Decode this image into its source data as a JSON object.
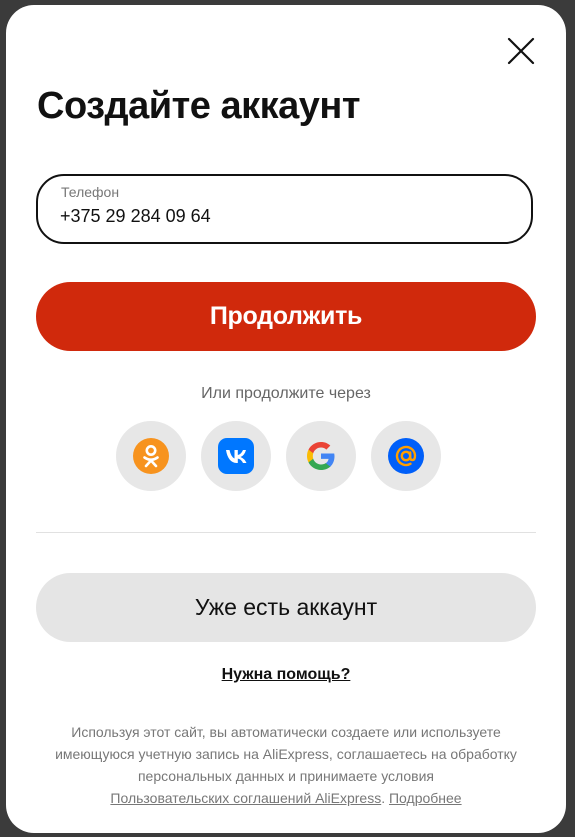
{
  "modal": {
    "title": "Создайте аккаунт",
    "phone": {
      "label": "Телефон",
      "value": "+375 29 284 09 64"
    },
    "continue_label": "Продолжить",
    "alt_prompt": "Или продолжите через",
    "social": [
      {
        "name": "odnoklassniki",
        "icon": "odnoklassniki-icon",
        "color": "#f7931e"
      },
      {
        "name": "vk",
        "icon": "vk-icon",
        "color": "#0077ff"
      },
      {
        "name": "google",
        "icon": "google-icon",
        "color": "#4285f4"
      },
      {
        "name": "mail",
        "icon": "mail-ru-icon",
        "color": "#005ff9"
      }
    ],
    "login_label": "Уже есть аккаунт",
    "help_label": "Нужна помощь?",
    "legal": {
      "text": "Используя этот сайт, вы автоматически создаете или используете имеющуюся учетную запись на AliExpress, соглашаетесь на обработку персональных данных и принимаете условия",
      "agreements_link": "Пользовательских соглашений AliExpress",
      "separator": ".",
      "more_link": "Подробнее"
    }
  },
  "colors": {
    "accent": "#d0290c",
    "secondary_button": "#e5e5e5"
  }
}
